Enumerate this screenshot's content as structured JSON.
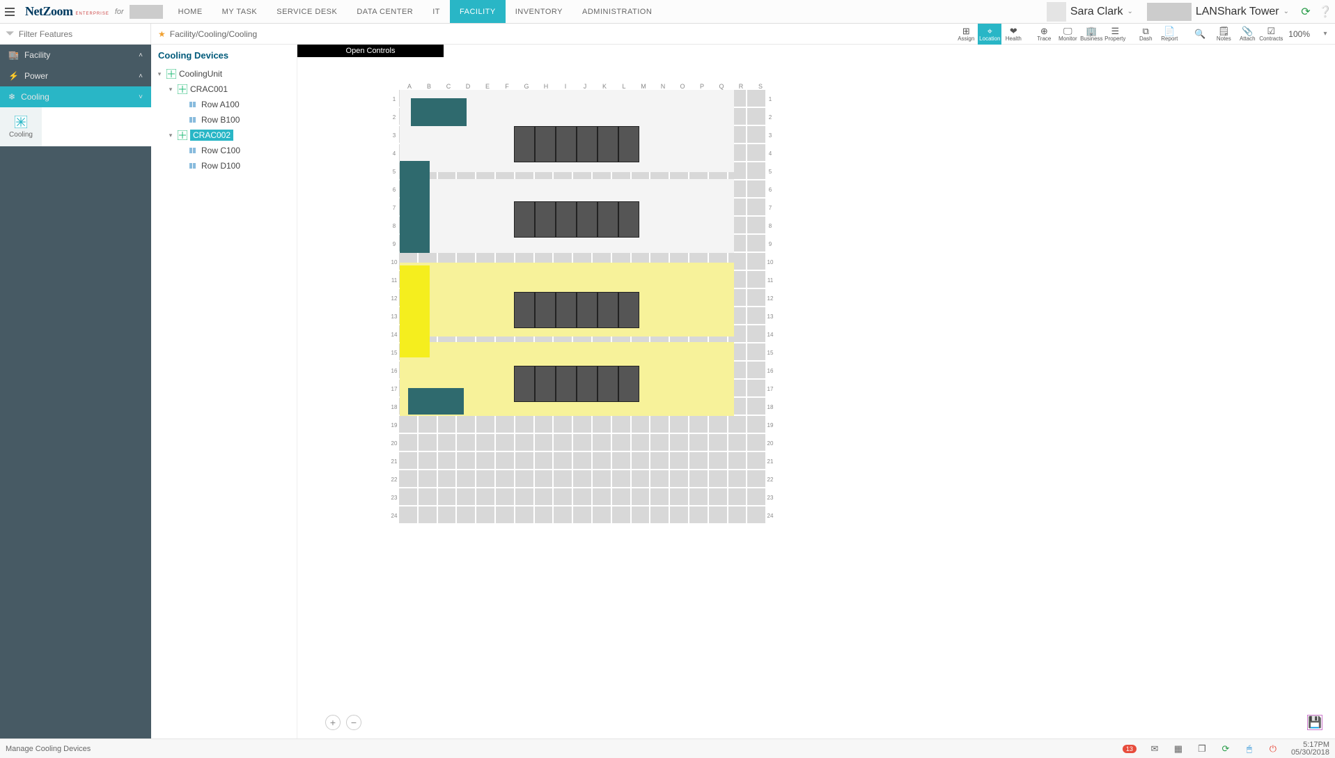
{
  "app": {
    "brand": "NetZoom",
    "brand_sub": "ENTERPRISE",
    "for": "for"
  },
  "menu": [
    "HOME",
    "MY TASK",
    "SERVICE DESK",
    "DATA CENTER",
    "IT",
    "FACILITY",
    "INVENTORY",
    "ADMINISTRATION"
  ],
  "menu_active": 5,
  "user": {
    "name": "Sara Clark"
  },
  "tower": {
    "name": "LANShark Tower"
  },
  "filter": {
    "placeholder": "Filter Features"
  },
  "breadcrumb": "Facility/Cooling/Cooling",
  "toolbar": [
    {
      "id": "assign",
      "label": "Assign",
      "icon": "⊞"
    },
    {
      "id": "location",
      "label": "Location",
      "icon": "⌖",
      "active": true
    },
    {
      "id": "health",
      "label": "Health",
      "icon": "❤"
    },
    {
      "id": "gap",
      "label": "",
      "icon": ""
    },
    {
      "id": "trace",
      "label": "Trace",
      "icon": "⊕"
    },
    {
      "id": "monitor",
      "label": "Monitor",
      "icon": "🖵"
    },
    {
      "id": "business",
      "label": "Business",
      "icon": "🏢"
    },
    {
      "id": "property",
      "label": "Property",
      "icon": "☰"
    },
    {
      "id": "gap2",
      "label": "",
      "icon": ""
    },
    {
      "id": "dash",
      "label": "Dash",
      "icon": "⧉"
    },
    {
      "id": "report",
      "label": "Report",
      "icon": "📄"
    },
    {
      "id": "gap3",
      "label": "",
      "icon": ""
    },
    {
      "id": "search",
      "label": "",
      "icon": "🔍"
    },
    {
      "id": "notes",
      "label": "Notes",
      "icon": "🗒"
    },
    {
      "id": "attach",
      "label": "Attach",
      "icon": "📎"
    },
    {
      "id": "contracts",
      "label": "Contracts",
      "icon": "☑"
    }
  ],
  "zoom": "100%",
  "sidebar": [
    {
      "id": "facility",
      "label": "Facility",
      "icon": "🏬",
      "exp": "˄"
    },
    {
      "id": "power",
      "label": "Power",
      "icon": "⚡",
      "exp": "˄"
    },
    {
      "id": "cooling",
      "label": "Cooling",
      "icon": "❄",
      "exp": "˅",
      "active": true
    }
  ],
  "sidebar_sub": {
    "label": "Cooling"
  },
  "tree": {
    "header": "Cooling Devices",
    "nodes": [
      {
        "depth": 0,
        "toggle": "▾",
        "icon": "fan",
        "label": "CoolingUnit"
      },
      {
        "depth": 1,
        "toggle": "▾",
        "icon": "fan",
        "label": "CRAC001"
      },
      {
        "depth": 2,
        "toggle": "",
        "icon": "row",
        "label": "Row A100"
      },
      {
        "depth": 2,
        "toggle": "",
        "icon": "row",
        "label": "Row B100"
      },
      {
        "depth": 1,
        "toggle": "▾",
        "icon": "fan",
        "label": "CRAC002",
        "selected": true
      },
      {
        "depth": 2,
        "toggle": "",
        "icon": "row",
        "label": "Row C100"
      },
      {
        "depth": 2,
        "toggle": "",
        "icon": "row",
        "label": "Row D100"
      }
    ]
  },
  "canvas": {
    "open_controls": "Open Controls",
    "columns": [
      "A",
      "B",
      "C",
      "D",
      "E",
      "F",
      "G",
      "H",
      "I",
      "J",
      "K",
      "L",
      "M",
      "N",
      "O",
      "P",
      "Q",
      "R",
      "S"
    ],
    "row_count": 24
  },
  "status": {
    "left": "Manage Cooling Devices",
    "badge": "13",
    "time": "5:17PM",
    "date": "05/30/2018"
  }
}
